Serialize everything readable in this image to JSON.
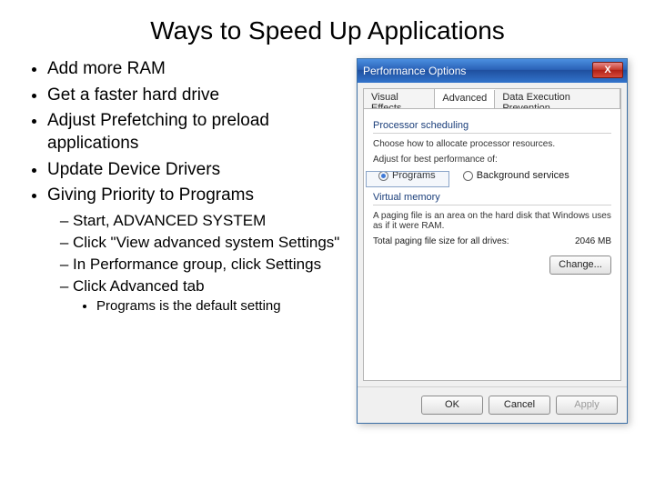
{
  "title": "Ways to Speed Up Applications",
  "bullets": {
    "b1": "Add more RAM",
    "b2": "Get a faster hard drive",
    "b3": "Adjust Prefetching to preload applications",
    "b4": "Update Device Drivers",
    "b5": "Giving Priority to Programs",
    "s1": "Start, ADVANCED SYSTEM",
    "s2": "Click \"View advanced system Settings\"",
    "s3": "In Performance group, click Settings",
    "s4": "Click Advanced tab",
    "ss1": "Programs is the default setting"
  },
  "dialog": {
    "title": "Performance Options",
    "close": "X",
    "tabs": {
      "t1": "Visual Effects",
      "t2": "Advanced",
      "t3": "Data Execution Prevention"
    },
    "sched": {
      "heading": "Processor scheduling",
      "desc": "Choose how to allocate processor resources.",
      "adjust": "Adjust for best performance of:",
      "programs": "Programs",
      "bg": "Background services"
    },
    "vm": {
      "heading": "Virtual memory",
      "desc": "A paging file is an area on the hard disk that Windows uses as if it were RAM.",
      "total_label": "Total paging file size for all drives:",
      "total_value": "2046 MB",
      "change": "Change..."
    },
    "footer": {
      "ok": "OK",
      "cancel": "Cancel",
      "apply": "Apply"
    }
  }
}
